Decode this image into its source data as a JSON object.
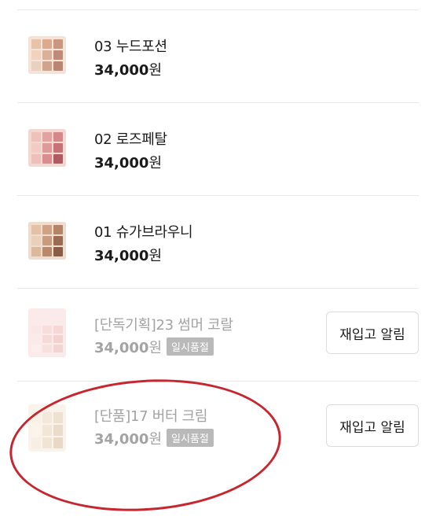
{
  "products": [
    {
      "name": "03 누드포션",
      "price": "34,000",
      "currency": "원",
      "sold_out": false,
      "swatches": [
        "#e9c3a8",
        "#dcab8f",
        "#c99680",
        "#f1d2bd",
        "#d9b09a",
        "#c08a78",
        "#ead0bf",
        "#cfa38c",
        "#b98672"
      ]
    },
    {
      "name": "02 로즈페탈",
      "price": "34,000",
      "currency": "원",
      "sold_out": false,
      "swatches": [
        "#efc1bb",
        "#e3a29f",
        "#d5878a",
        "#f2cbc3",
        "#dd9a99",
        "#c77277",
        "#efbfba",
        "#d98d8f",
        "#b05a61"
      ]
    },
    {
      "name": "01 슈가브라우니",
      "price": "34,000",
      "currency": "원",
      "sold_out": false,
      "swatches": [
        "#e4c1a4",
        "#cfa283",
        "#b58466",
        "#ead0b8",
        "#c79b7c",
        "#9b6c52",
        "#dcb89c",
        "#b9896b",
        "#8a5d46"
      ]
    },
    {
      "name": "[단독기획]23 썸머 코랄",
      "price": "34,000",
      "currency": "원",
      "sold_out": true,
      "badge": "일시품절",
      "button": "재입고 알림",
      "swatches": [
        "#f6d5d1",
        "#f1c4c0",
        "#efb8b4",
        "#f7dcd8",
        "#f0bdb8",
        "#eaaca8",
        "#f9e2df",
        "#f2c9c5",
        "#e9b1ac"
      ]
    },
    {
      "name": "[단품]17 버터 크림",
      "price": "34,000",
      "currency": "원",
      "sold_out": true,
      "badge": "일시품절",
      "button": "재입고 알림",
      "swatches": [
        "#f3e6d2",
        "#ead7bd",
        "#e2c9ab",
        "#f6ecdc",
        "#e8d3b8",
        "#dcbf9f",
        "#f1e3cf",
        "#e5cfb3",
        "#d8b997"
      ]
    }
  ]
}
